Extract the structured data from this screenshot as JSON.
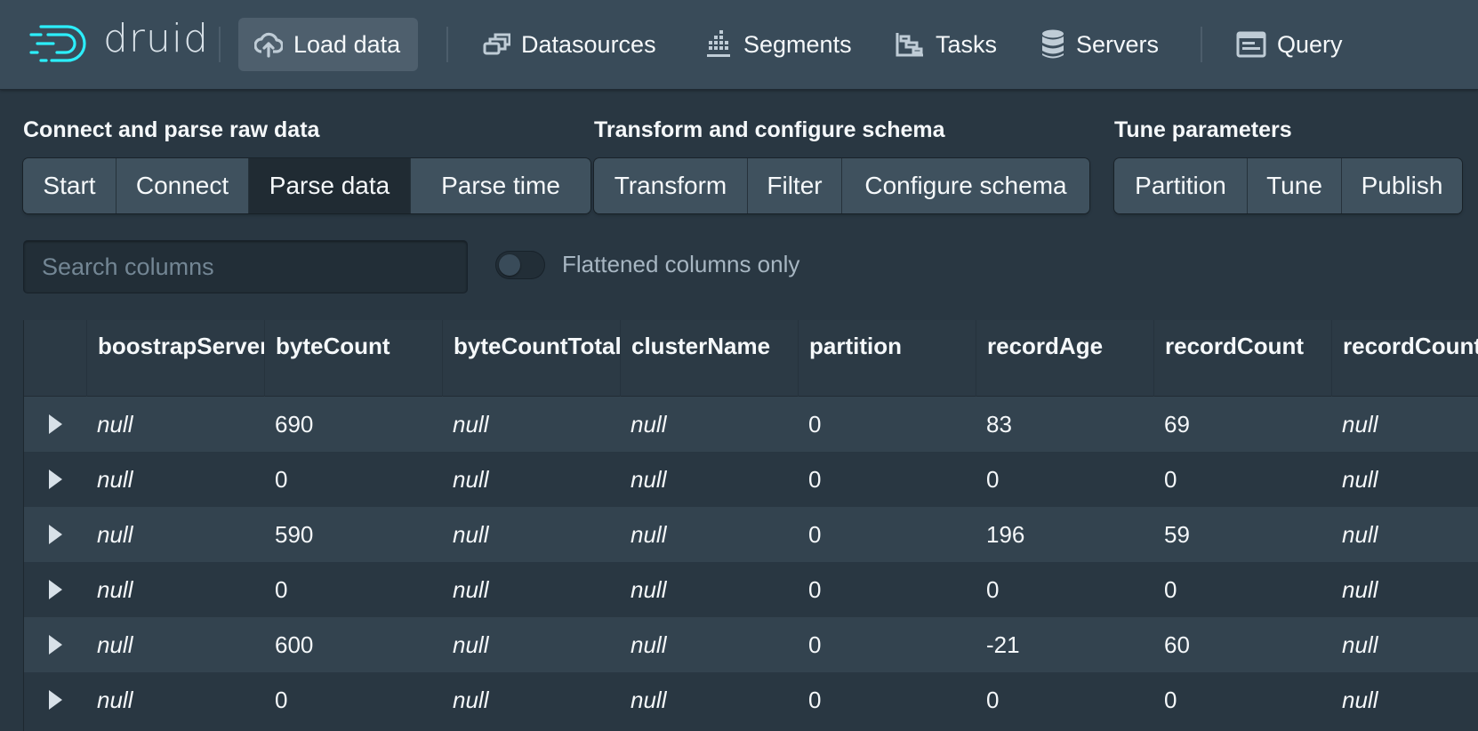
{
  "app": {
    "name": "druid"
  },
  "nav": {
    "items": [
      {
        "label": "Load data",
        "icon": "cloud-upload-icon",
        "active": true
      },
      {
        "label": "Datasources",
        "icon": "datasources-icon"
      },
      {
        "label": "Segments",
        "icon": "segments-icon"
      },
      {
        "label": "Tasks",
        "icon": "tasks-icon"
      },
      {
        "label": "Servers",
        "icon": "database-icon"
      },
      {
        "label": "Query",
        "icon": "application-icon"
      }
    ]
  },
  "wizard": {
    "sections": [
      {
        "title": "Connect and parse raw data",
        "steps": [
          "Start",
          "Connect",
          "Parse data",
          "Parse time"
        ]
      },
      {
        "title": "Transform and configure schema",
        "steps": [
          "Transform",
          "Filter",
          "Configure schema"
        ]
      },
      {
        "title": "Tune parameters",
        "steps": [
          "Partition",
          "Tune",
          "Publish"
        ]
      }
    ],
    "active_step": "Parse data"
  },
  "search": {
    "placeholder": "Search columns",
    "value": ""
  },
  "toggle": {
    "label": "Flattened columns only",
    "checked": false
  },
  "table": {
    "columns": [
      "boostrapServers",
      "byteCount",
      "byteCountTotal",
      "clusterName",
      "partition",
      "recordAge",
      "recordCount",
      "recordCountTotal"
    ],
    "rows": [
      [
        "null",
        "690",
        "null",
        "null",
        "0",
        "83",
        "69",
        "null"
      ],
      [
        "null",
        "0",
        "null",
        "null",
        "0",
        "0",
        "0",
        "null"
      ],
      [
        "null",
        "590",
        "null",
        "null",
        "0",
        "196",
        "59",
        "null"
      ],
      [
        "null",
        "0",
        "null",
        "null",
        "0",
        "0",
        "0",
        "null"
      ],
      [
        "null",
        "600",
        "null",
        "null",
        "0",
        "-21",
        "60",
        "null"
      ],
      [
        "null",
        "0",
        "null",
        "null",
        "0",
        "0",
        "0",
        "null"
      ]
    ]
  },
  "colors": {
    "background": "#293742",
    "navbar": "#394b59",
    "logo": "#2ceefb",
    "step_active": "#202b33"
  }
}
